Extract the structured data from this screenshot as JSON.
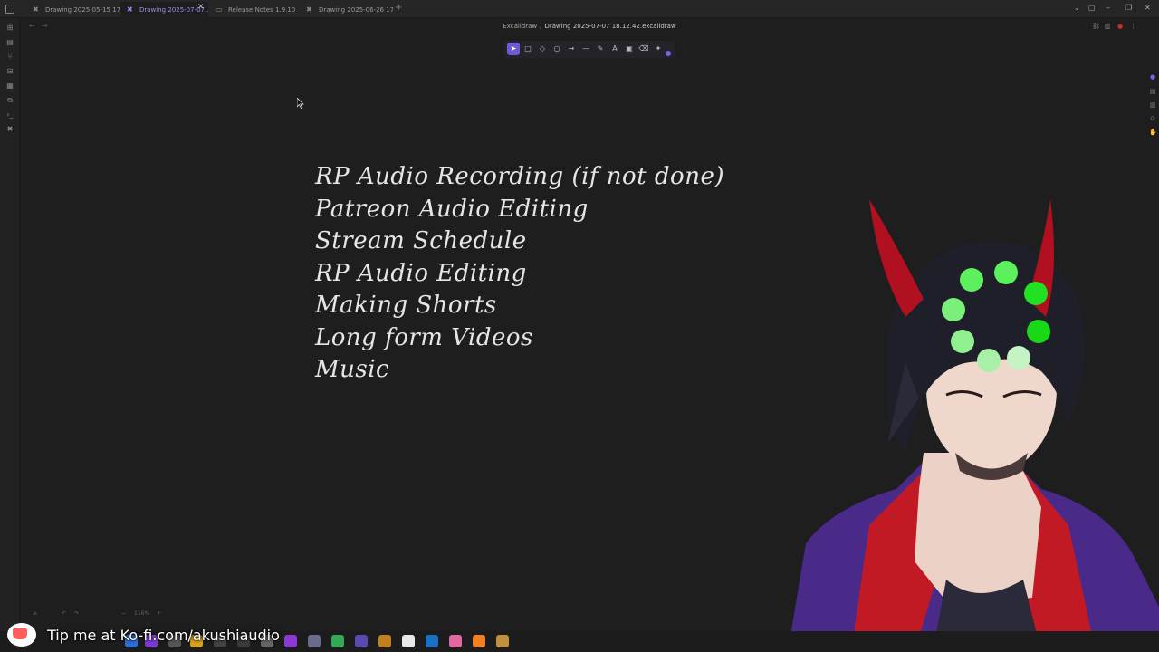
{
  "tabs": [
    {
      "label": "Drawing 2025-05-15 17.2...",
      "active": false
    },
    {
      "label": "Drawing 2025-07-07...",
      "active": true
    },
    {
      "label": "Release Notes 1.9.10",
      "active": false
    },
    {
      "label": "Drawing 2025-06-26 17.5...",
      "active": false
    }
  ],
  "breadcrumb": {
    "folder": "Excalidraw",
    "separator": "/",
    "file": "Drawing 2025-07-07 18.12.42.excalidraw"
  },
  "drawing": {
    "lines": [
      "RP Audio Recording (if not done)",
      "Patreon Audio Editing",
      "Stream Schedule",
      "RP Audio Editing",
      "Making Shorts",
      "Long form Videos",
      "Music"
    ]
  },
  "zoom": "116%",
  "kofi": {
    "text": "Tip me at Ko-fi.com/akushiaudio"
  },
  "colors": {
    "accent": "#7a62e0",
    "background": "#1e1e1e",
    "text": "#e6e6e6"
  }
}
